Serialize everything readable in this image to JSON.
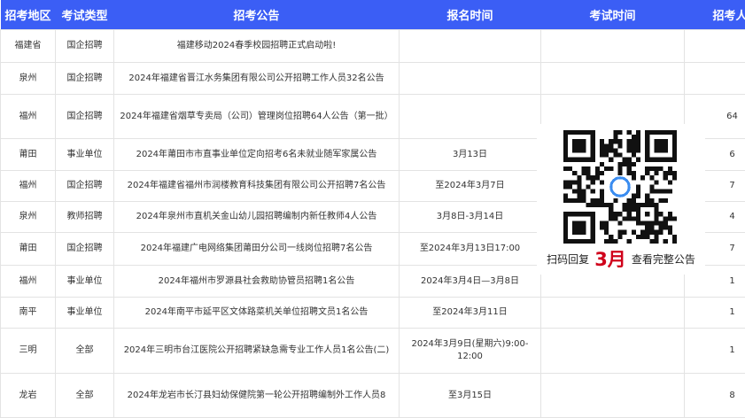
{
  "table": {
    "headers": [
      "招考地区",
      "考试类型",
      "招考公告",
      "报名时间",
      "考试时间",
      "招考人数"
    ],
    "rows": [
      {
        "region": "福建省",
        "type": "国企招聘",
        "notice": "福建移动2024春季校园招聘正式启动啦!",
        "signup": "",
        "exam": "",
        "count": ""
      },
      {
        "region": "泉州",
        "type": "国企招聘",
        "notice": "2024年福建省晋江水务集团有限公司公开招聘工作人员32名公告",
        "signup": "",
        "exam": "",
        "count": ""
      },
      {
        "region": "福州",
        "type": "国企招聘",
        "notice": "2024年福建省烟草专卖局（公司）管理岗位招聘64人公告（第一批）",
        "signup": "",
        "exam": "",
        "count": "64"
      },
      {
        "region": "莆田",
        "type": "事业单位",
        "notice": "2024年莆田市市直事业单位定向招考6名未就业随军家属公告",
        "signup": "3月13日",
        "exam": "",
        "count": "6"
      },
      {
        "region": "福州",
        "type": "国企招聘",
        "notice": "2024年福建省福州市润楼教育科技集团有限公司公开招聘7名公告",
        "signup": "至2024年3月7日",
        "exam": "",
        "count": "7"
      },
      {
        "region": "泉州",
        "type": "教师招聘",
        "notice": "2024年泉州市直机关金山幼儿园招聘编制内新任教师4人公告",
        "signup": "3月8日-3月14日",
        "exam": "",
        "count": "4"
      },
      {
        "region": "莆田",
        "type": "国企招聘",
        "notice": "2024年福建广电网络集团莆田分公司一线岗位招聘7名公告",
        "signup": "至2024年3月13日17:00",
        "exam": "",
        "count": "7"
      },
      {
        "region": "福州",
        "type": "事业单位",
        "notice": "2024年福州市罗源县社会救助协管员招聘1名公告",
        "signup": "2024年3月4日—3月8日",
        "exam": "",
        "count": "1"
      },
      {
        "region": "南平",
        "type": "事业单位",
        "notice": "2024年南平市延平区文体路菜机关单位招聘文员1名公告",
        "signup": "至2024年3月11日",
        "exam": "",
        "count": "1"
      },
      {
        "region": "三明",
        "type": "全部",
        "notice": "2024年三明市台江医院公开招聘紧缺急需专业工作人员1名公告(二)",
        "signup": "2024年3月9日(星期六)9:00-12:00",
        "exam": "",
        "count": "1"
      },
      {
        "region": "龙岩",
        "type": "全部",
        "notice": "2024年龙岩市长汀县妇幼保健院第一轮公开招聘编制外工作人员8",
        "signup": "至3月15日",
        "exam": "",
        "count": "8"
      }
    ]
  },
  "qr": {
    "caption_before": "扫码回复",
    "month": "3月",
    "caption_after": "查看完整公告"
  }
}
